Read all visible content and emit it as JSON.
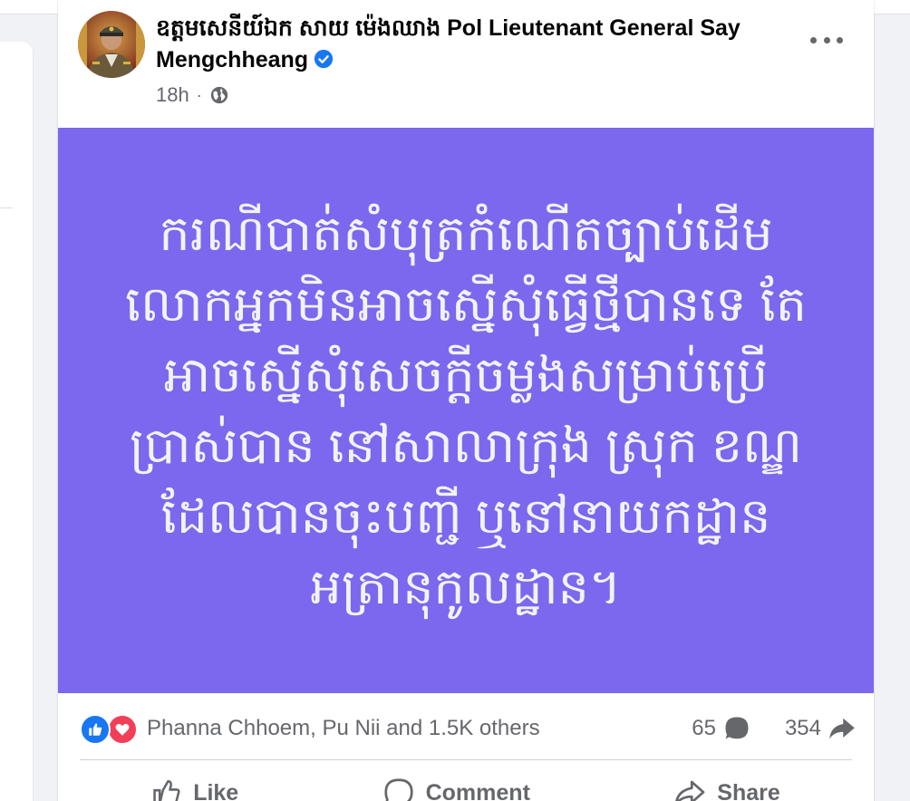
{
  "post": {
    "author": "ឧត្តមសេនីយ៍ឯក សាយ ម៉េងឈាង Pol Lieutenant General Say Mengchheang",
    "verified": true,
    "time": "18h",
    "separator": "·",
    "audience_icon": "globe-icon",
    "menu_icon": "more-options-icon",
    "background_color": "#7b68ee",
    "text_color": "#f2f2f2",
    "body_lines": [
      "ករណីបាត់សំបុត្រកំណើតច្បាប់ដើម",
      "លោកអ្នកមិនអាចស្នើសុំធ្វើថ្មីបានទេ តែ",
      "អាចស្នើសុំសេចក្តីចម្លងសម្រាប់ប្រើ",
      "ប្រាស់បាន នៅសាលាក្រុង ស្រុក ខណ្ឌ",
      "ដែលបានចុះបញ្ជី ឬនៅនាយកដ្ឋាន",
      "អត្រានុកូលដ្ឋាន។"
    ]
  },
  "reactions": {
    "icons": [
      "like-reaction-icon",
      "love-reaction-icon"
    ],
    "summary": "Phanna Chhoem, Pu Nii and 1.5K others",
    "comments_count": "65",
    "shares_count": "354"
  },
  "actions": {
    "like": "Like",
    "comment": "Comment",
    "share": "Share"
  },
  "colors": {
    "accent": "#1877f2",
    "love": "#f33e58",
    "secondary_text": "#65676b"
  }
}
